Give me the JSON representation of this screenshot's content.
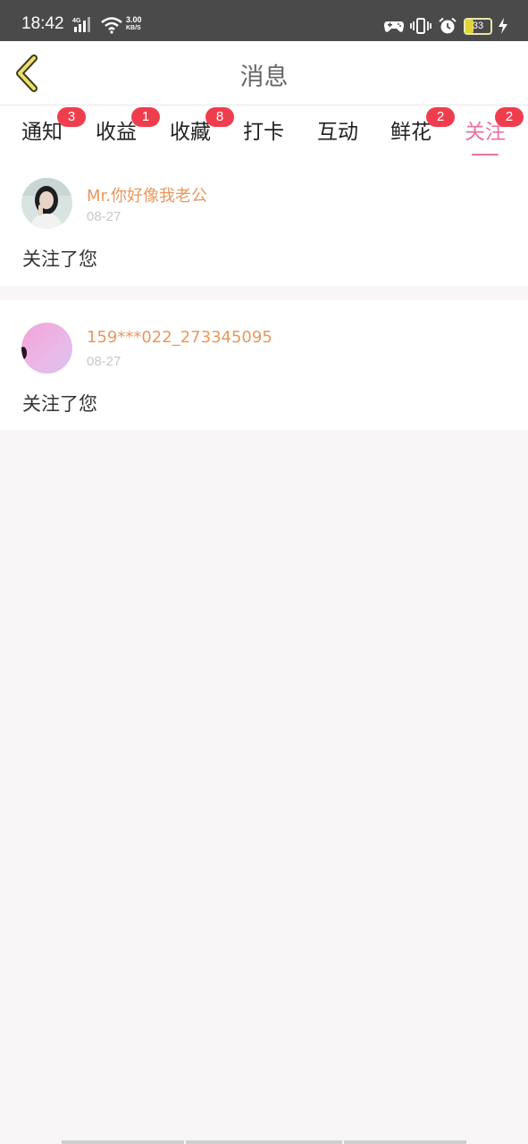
{
  "status_bar": {
    "time": "18:42",
    "network_type": "4G",
    "speed_value": "3.00",
    "speed_unit": "KB/S",
    "battery_level": "33",
    "icons": [
      "signal-icon",
      "wifi-icon",
      "game-controller-icon",
      "vibrate-icon",
      "alarm-icon",
      "battery-icon",
      "charging-icon"
    ]
  },
  "header": {
    "title": "消息",
    "back_icon": "chevron-left-icon"
  },
  "tabs": [
    {
      "label": "通知",
      "badge": "3",
      "active": false
    },
    {
      "label": "收益",
      "badge": "1",
      "active": false
    },
    {
      "label": "收藏",
      "badge": "8",
      "active": false
    },
    {
      "label": "打卡",
      "badge": "",
      "active": false
    },
    {
      "label": "互动",
      "badge": "",
      "active": false
    },
    {
      "label": "鲜花",
      "badge": "2",
      "active": false
    },
    {
      "label": "关注",
      "badge": "2",
      "active": true
    }
  ],
  "messages": [
    {
      "username": "Mr.你好像我老公",
      "date": "08-27",
      "text": "关注了您",
      "avatar": "user-photo-avatar"
    },
    {
      "username": "159***022_273345095",
      "date": "08-27",
      "text": "关注了您",
      "avatar": "pink-avatar"
    }
  ],
  "colors": {
    "accent": "#ea71a3",
    "username": "#e9975e",
    "badge": "#ee3e4e",
    "status_bar": "#4a4a4a",
    "background": "#f8f6f7"
  }
}
